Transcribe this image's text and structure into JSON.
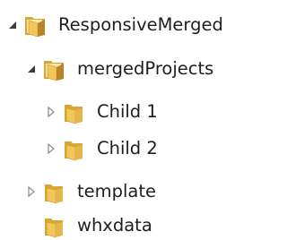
{
  "tree": {
    "root": {
      "label": "ResponsiveMerged",
      "expanded": true,
      "children": [
        {
          "label": "mergedProjects",
          "expanded": true,
          "children": [
            {
              "label": "Child 1",
              "expanded": false
            },
            {
              "label": "Child 2",
              "expanded": false
            }
          ]
        },
        {
          "label": "template",
          "expanded": false
        },
        {
          "label": "whxdata"
        }
      ]
    }
  },
  "icons": {
    "expanded_toggle": "expanded-triangle-icon",
    "collapsed_toggle": "collapsed-triangle-icon",
    "folder": "folder-icon"
  },
  "colors": {
    "folder_front": "#f1c75a",
    "folder_back": "#d9a632",
    "folder_inner": "#b88526",
    "toggle_expanded": "#3c3c3c",
    "toggle_collapsed": "#8a8a8a"
  }
}
